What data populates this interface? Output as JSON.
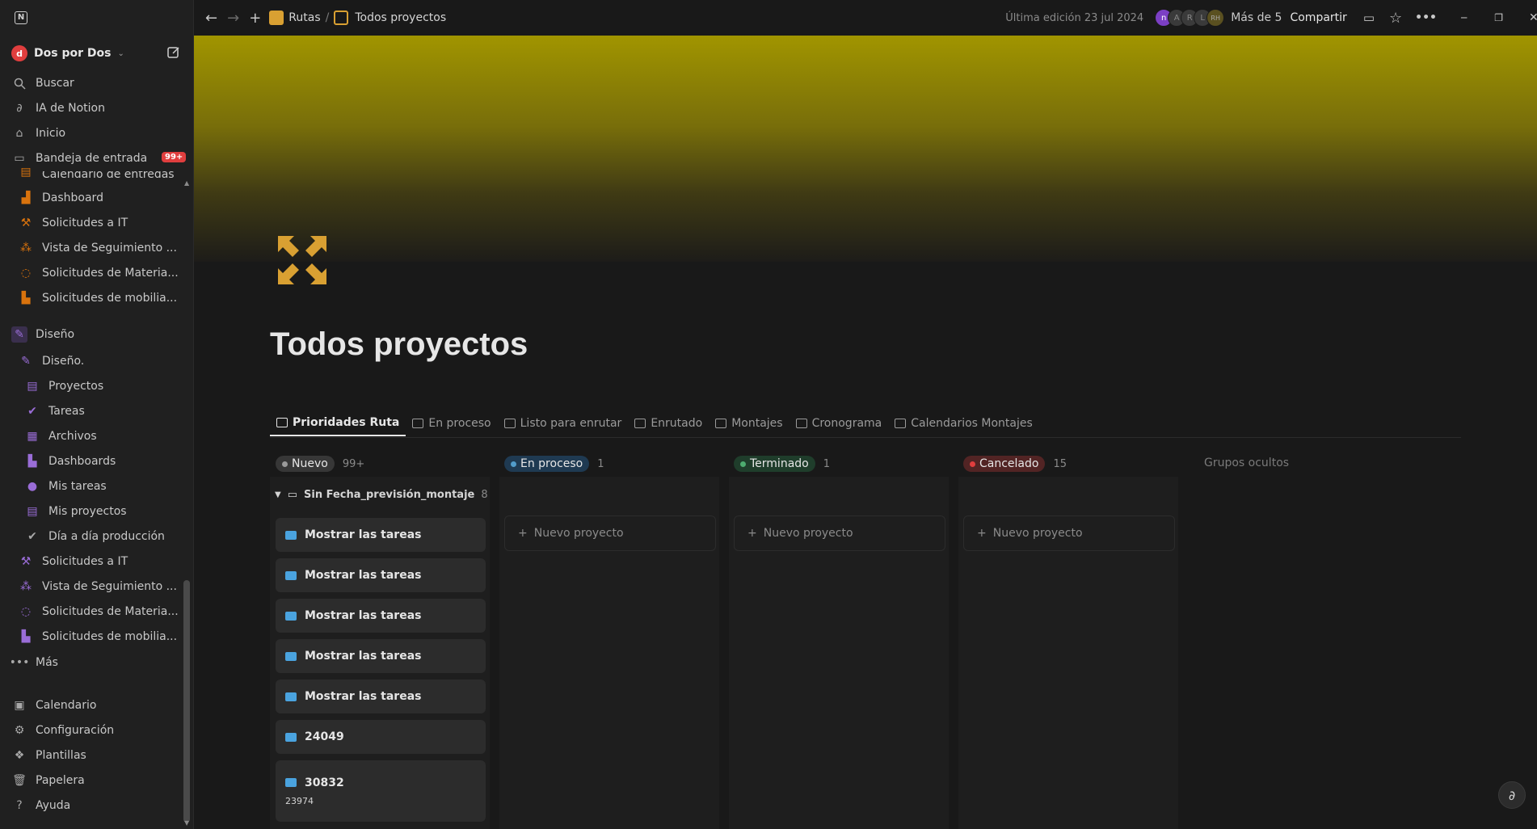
{
  "sidebar": {
    "workspace_logo": "d",
    "workspace_name": "Dos por Dos",
    "top_items": [
      {
        "label": "Buscar",
        "icon": "search-icon"
      },
      {
        "label": "IA de Notion",
        "icon": "ai-icon"
      },
      {
        "label": "Inicio",
        "icon": "home-icon"
      },
      {
        "label": "Bandeja de entrada",
        "icon": "inbox-icon"
      }
    ],
    "inbox_badge": "99+",
    "partial_item": "Calendario de entregas",
    "items": [
      {
        "label": "Dashboard",
        "icon": "chart-icon"
      },
      {
        "label": "Solicitudes a IT",
        "icon": "wrench-icon"
      },
      {
        "label": "Vista de Seguimiento ...",
        "icon": "people-icon"
      },
      {
        "label": "Solicitudes de Materia...",
        "icon": "dashed-circle-icon"
      },
      {
        "label": "Solicitudes de mobilia...",
        "icon": "building-icon"
      }
    ],
    "section": {
      "label": "Diseño",
      "icon": "pencil-icon"
    },
    "section_items": [
      {
        "label": "Diseño.",
        "icon": "pencil-icon"
      },
      {
        "label": "Proyectos",
        "icon": "stack-icon"
      },
      {
        "label": "Tareas",
        "icon": "check-circle-icon"
      },
      {
        "label": "Archivos",
        "icon": "archive-icon"
      },
      {
        "label": "Dashboards",
        "icon": "bars-icon"
      },
      {
        "label": "Mis tareas",
        "icon": "person-icon"
      },
      {
        "label": "Mis proyectos",
        "icon": "stack-icon"
      },
      {
        "label": "Día a día producción",
        "icon": "check-circle-icon"
      },
      {
        "label": "Solicitudes a IT",
        "icon": "wrench-icon"
      },
      {
        "label": "Vista de Seguimiento ...",
        "icon": "people-icon"
      },
      {
        "label": "Solicitudes de Materia...",
        "icon": "dashed-circle-icon"
      },
      {
        "label": "Solicitudes de mobilia...",
        "icon": "building-icon"
      }
    ],
    "more": "Más",
    "bottom_items": [
      {
        "label": "Calendario",
        "icon": "calendar-icon"
      },
      {
        "label": "Configuración",
        "icon": "gear-icon"
      },
      {
        "label": "Plantillas",
        "icon": "templates-icon"
      },
      {
        "label": "Papelera",
        "icon": "trash-icon"
      },
      {
        "label": "Ayuda",
        "icon": "help-icon"
      }
    ]
  },
  "topbar": {
    "crumb1": "Rutas",
    "crumb_sep": "/",
    "crumb2": "Todos proyectos",
    "last_edit": "Última edición 23 jul 2024",
    "avatars": [
      "n",
      "A",
      "R",
      "L",
      "RH"
    ],
    "more_people": "Más de 5",
    "share": "Compartir"
  },
  "page": {
    "title": "Todos proyectos"
  },
  "tabs": [
    {
      "label": "Prioridades Ruta",
      "active": true
    },
    {
      "label": "En proceso",
      "active": false
    },
    {
      "label": "Listo para enrutar",
      "active": false
    },
    {
      "label": "Enrutado",
      "active": false
    },
    {
      "label": "Montajes",
      "active": false
    },
    {
      "label": "Cronograma",
      "active": false
    },
    {
      "label": "Calendarios Montajes",
      "active": false
    }
  ],
  "board": {
    "columns": [
      {
        "label": "Nuevo",
        "count": "99+",
        "color": "#9b9b9b",
        "pill": "#373737"
      },
      {
        "label": "En proceso",
        "count": "1",
        "color": "#529cca",
        "pill": "#1f3a52"
      },
      {
        "label": "Terminado",
        "count": "1",
        "color": "#4dab6f",
        "pill": "#1f3d2b"
      },
      {
        "label": "Cancelado",
        "count": "15",
        "color": "#e03e3e",
        "pill": "#522424"
      }
    ],
    "hidden_groups": "Grupos ocultos",
    "group": {
      "label": "Sin Fecha_previsión_montaje",
      "count": "8"
    },
    "cards": [
      {
        "title": "Mostrar las tareas"
      },
      {
        "title": "Mostrar las tareas"
      },
      {
        "title": "Mostrar las tareas"
      },
      {
        "title": "Mostrar las tareas"
      },
      {
        "title": "Mostrar las tareas"
      },
      {
        "title": "24049"
      },
      {
        "title": "30832",
        "sub": "23974"
      }
    ],
    "new_project": "Nuevo proyecto"
  }
}
